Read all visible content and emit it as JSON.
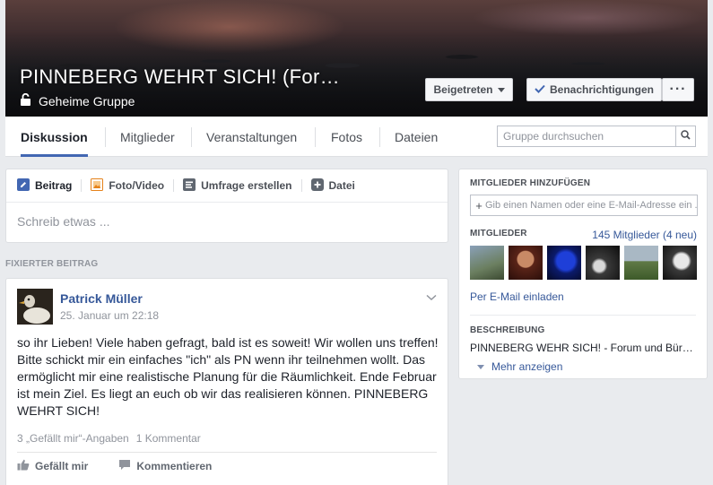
{
  "header": {
    "title": "PINNEBERG WEHRT SICH! (For…",
    "privacy": "Geheime Gruppe",
    "joined_label": "Beigetreten",
    "notifications_label": "Benachrichtigungen",
    "more_label": "···"
  },
  "tabs": [
    {
      "label": "Diskussion",
      "active": true
    },
    {
      "label": "Mitglieder"
    },
    {
      "label": "Veranstaltungen"
    },
    {
      "label": "Fotos"
    },
    {
      "label": "Dateien"
    }
  ],
  "search": {
    "placeholder": "Gruppe durchsuchen"
  },
  "composer": {
    "tabs": [
      {
        "label": "Beitrag",
        "icon": "pencil-icon"
      },
      {
        "label": "Foto/Video",
        "icon": "photo-icon"
      },
      {
        "label": "Umfrage erstellen",
        "icon": "poll-icon"
      },
      {
        "label": "Datei",
        "icon": "file-plus-icon"
      }
    ],
    "placeholder": "Schreib etwas ..."
  },
  "pinned_label": "FIXIERTER BEITRAG",
  "post": {
    "author": "Patrick Müller",
    "timestamp": "25. Januar um 22:18",
    "body": "so ihr Lieben! Viele haben gefragt, bald ist es soweit! Wir wollen uns treffen! Bitte schickt mir ein einfaches \"ich\" als PN wenn ihr teilnehmen wollt. Das ermöglicht mir eine realistische Planung für die Räumlichkeit. Ende Februar ist mein Ziel. Es liegt an euch ob wir das realisieren können. PINNEBERG WEHRT SICH!",
    "likes": "3 „Gefällt mir“-Angaben",
    "comments": "1 Kommentar",
    "like_action": "Gefällt mir",
    "comment_action": "Kommentieren"
  },
  "sidebar": {
    "add_members_heading": "MITGLIEDER HINZUFÜGEN",
    "add_members_placeholder": "Gib einen Namen oder eine E-Mail-Adresse ein ...",
    "members_heading": "MITGLIEDER",
    "members_count": "145 Mitglieder (4 neu)",
    "invite_email": "Per E-Mail einladen",
    "description_heading": "BESCHREIBUNG",
    "description": "PINNEBERG WEHR SICH! - Forum und Bür…",
    "show_more": "Mehr anzeigen"
  },
  "colors": {
    "accent": "#4267b2",
    "link": "#365899",
    "background": "#e9ebee"
  }
}
